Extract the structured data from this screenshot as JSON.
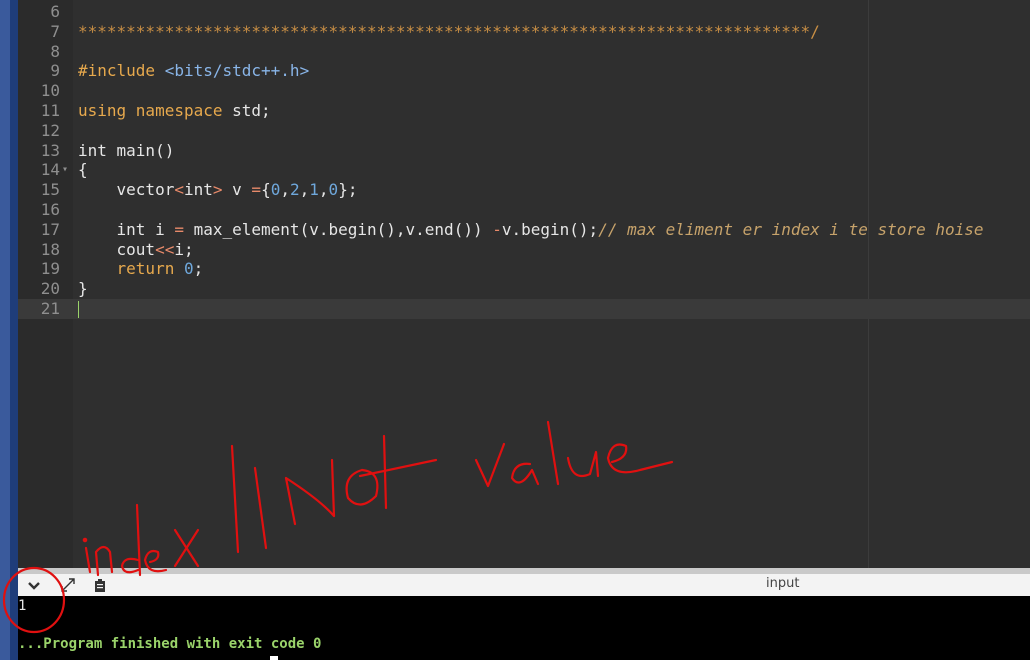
{
  "editor": {
    "lines": [
      {
        "n": "6",
        "fold": "",
        "parts": []
      },
      {
        "n": "7",
        "fold": "",
        "parts": [
          {
            "c": "stars",
            "t": "****************************************************************************/"
          }
        ]
      },
      {
        "n": "8",
        "fold": "",
        "parts": []
      },
      {
        "n": "9",
        "fold": "",
        "parts": [
          {
            "c": "pp",
            "t": "#include "
          },
          {
            "c": "inc",
            "t": "<bits/stdc++.h>"
          }
        ]
      },
      {
        "n": "10",
        "fold": "",
        "parts": []
      },
      {
        "n": "11",
        "fold": "",
        "parts": [
          {
            "c": "kw",
            "t": "using namespace "
          },
          {
            "c": "fn",
            "t": "std;"
          }
        ]
      },
      {
        "n": "12",
        "fold": "",
        "parts": []
      },
      {
        "n": "13",
        "fold": "",
        "parts": [
          {
            "c": "fn",
            "t": "int main()"
          }
        ]
      },
      {
        "n": "14",
        "fold": "▾",
        "parts": [
          {
            "c": "fn",
            "t": "{"
          }
        ]
      },
      {
        "n": "15",
        "fold": "",
        "parts": [
          {
            "c": "fn",
            "t": "    vector"
          },
          {
            "c": "op",
            "t": "<"
          },
          {
            "c": "fn",
            "t": "int"
          },
          {
            "c": "op",
            "t": ">"
          },
          {
            "c": "fn",
            "t": " v "
          },
          {
            "c": "op",
            "t": "="
          },
          {
            "c": "fn",
            "t": "{"
          },
          {
            "c": "num",
            "t": "0"
          },
          {
            "c": "fn",
            "t": ","
          },
          {
            "c": "num",
            "t": "2"
          },
          {
            "c": "fn",
            "t": ","
          },
          {
            "c": "num",
            "t": "1"
          },
          {
            "c": "fn",
            "t": ","
          },
          {
            "c": "num",
            "t": "0"
          },
          {
            "c": "fn",
            "t": "};"
          }
        ]
      },
      {
        "n": "16",
        "fold": "",
        "parts": []
      },
      {
        "n": "17",
        "fold": "",
        "parts": [
          {
            "c": "fn",
            "t": "    int i "
          },
          {
            "c": "op",
            "t": "="
          },
          {
            "c": "fn",
            "t": " max_element(v.begin(),v.end()) "
          },
          {
            "c": "op",
            "t": "-"
          },
          {
            "c": "fn",
            "t": "v.begin();"
          },
          {
            "c": "cmt",
            "t": "// max eliment er index i te store hoise"
          }
        ]
      },
      {
        "n": "18",
        "fold": "",
        "parts": [
          {
            "c": "fn",
            "t": "    cout"
          },
          {
            "c": "op",
            "t": "<<"
          },
          {
            "c": "fn",
            "t": "i;"
          }
        ]
      },
      {
        "n": "19",
        "fold": "",
        "parts": [
          {
            "c": "kw",
            "t": "    return "
          },
          {
            "c": "num",
            "t": "0"
          },
          {
            "c": "fn",
            "t": ";"
          }
        ]
      },
      {
        "n": "20",
        "fold": "",
        "parts": [
          {
            "c": "fn",
            "t": "}"
          }
        ]
      },
      {
        "n": "21",
        "fold": "",
        "parts": [],
        "active": true
      }
    ]
  },
  "toolbar": {
    "collapse_icon": "chevron-down-icon",
    "expand_icon": "expand-arrows-icon",
    "clipboard_icon": "clipboard-icon",
    "input_label": "input"
  },
  "terminal": {
    "output": "1",
    "status": "...Program finished with exit code 0"
  },
  "colors": {
    "editor_bg": "#2f2f2f",
    "keyword": "#e7a94d",
    "number": "#6fa8dc",
    "comment": "#c7a36b",
    "terminal_status": "#9ad36a",
    "annotation": "#e01010"
  }
}
